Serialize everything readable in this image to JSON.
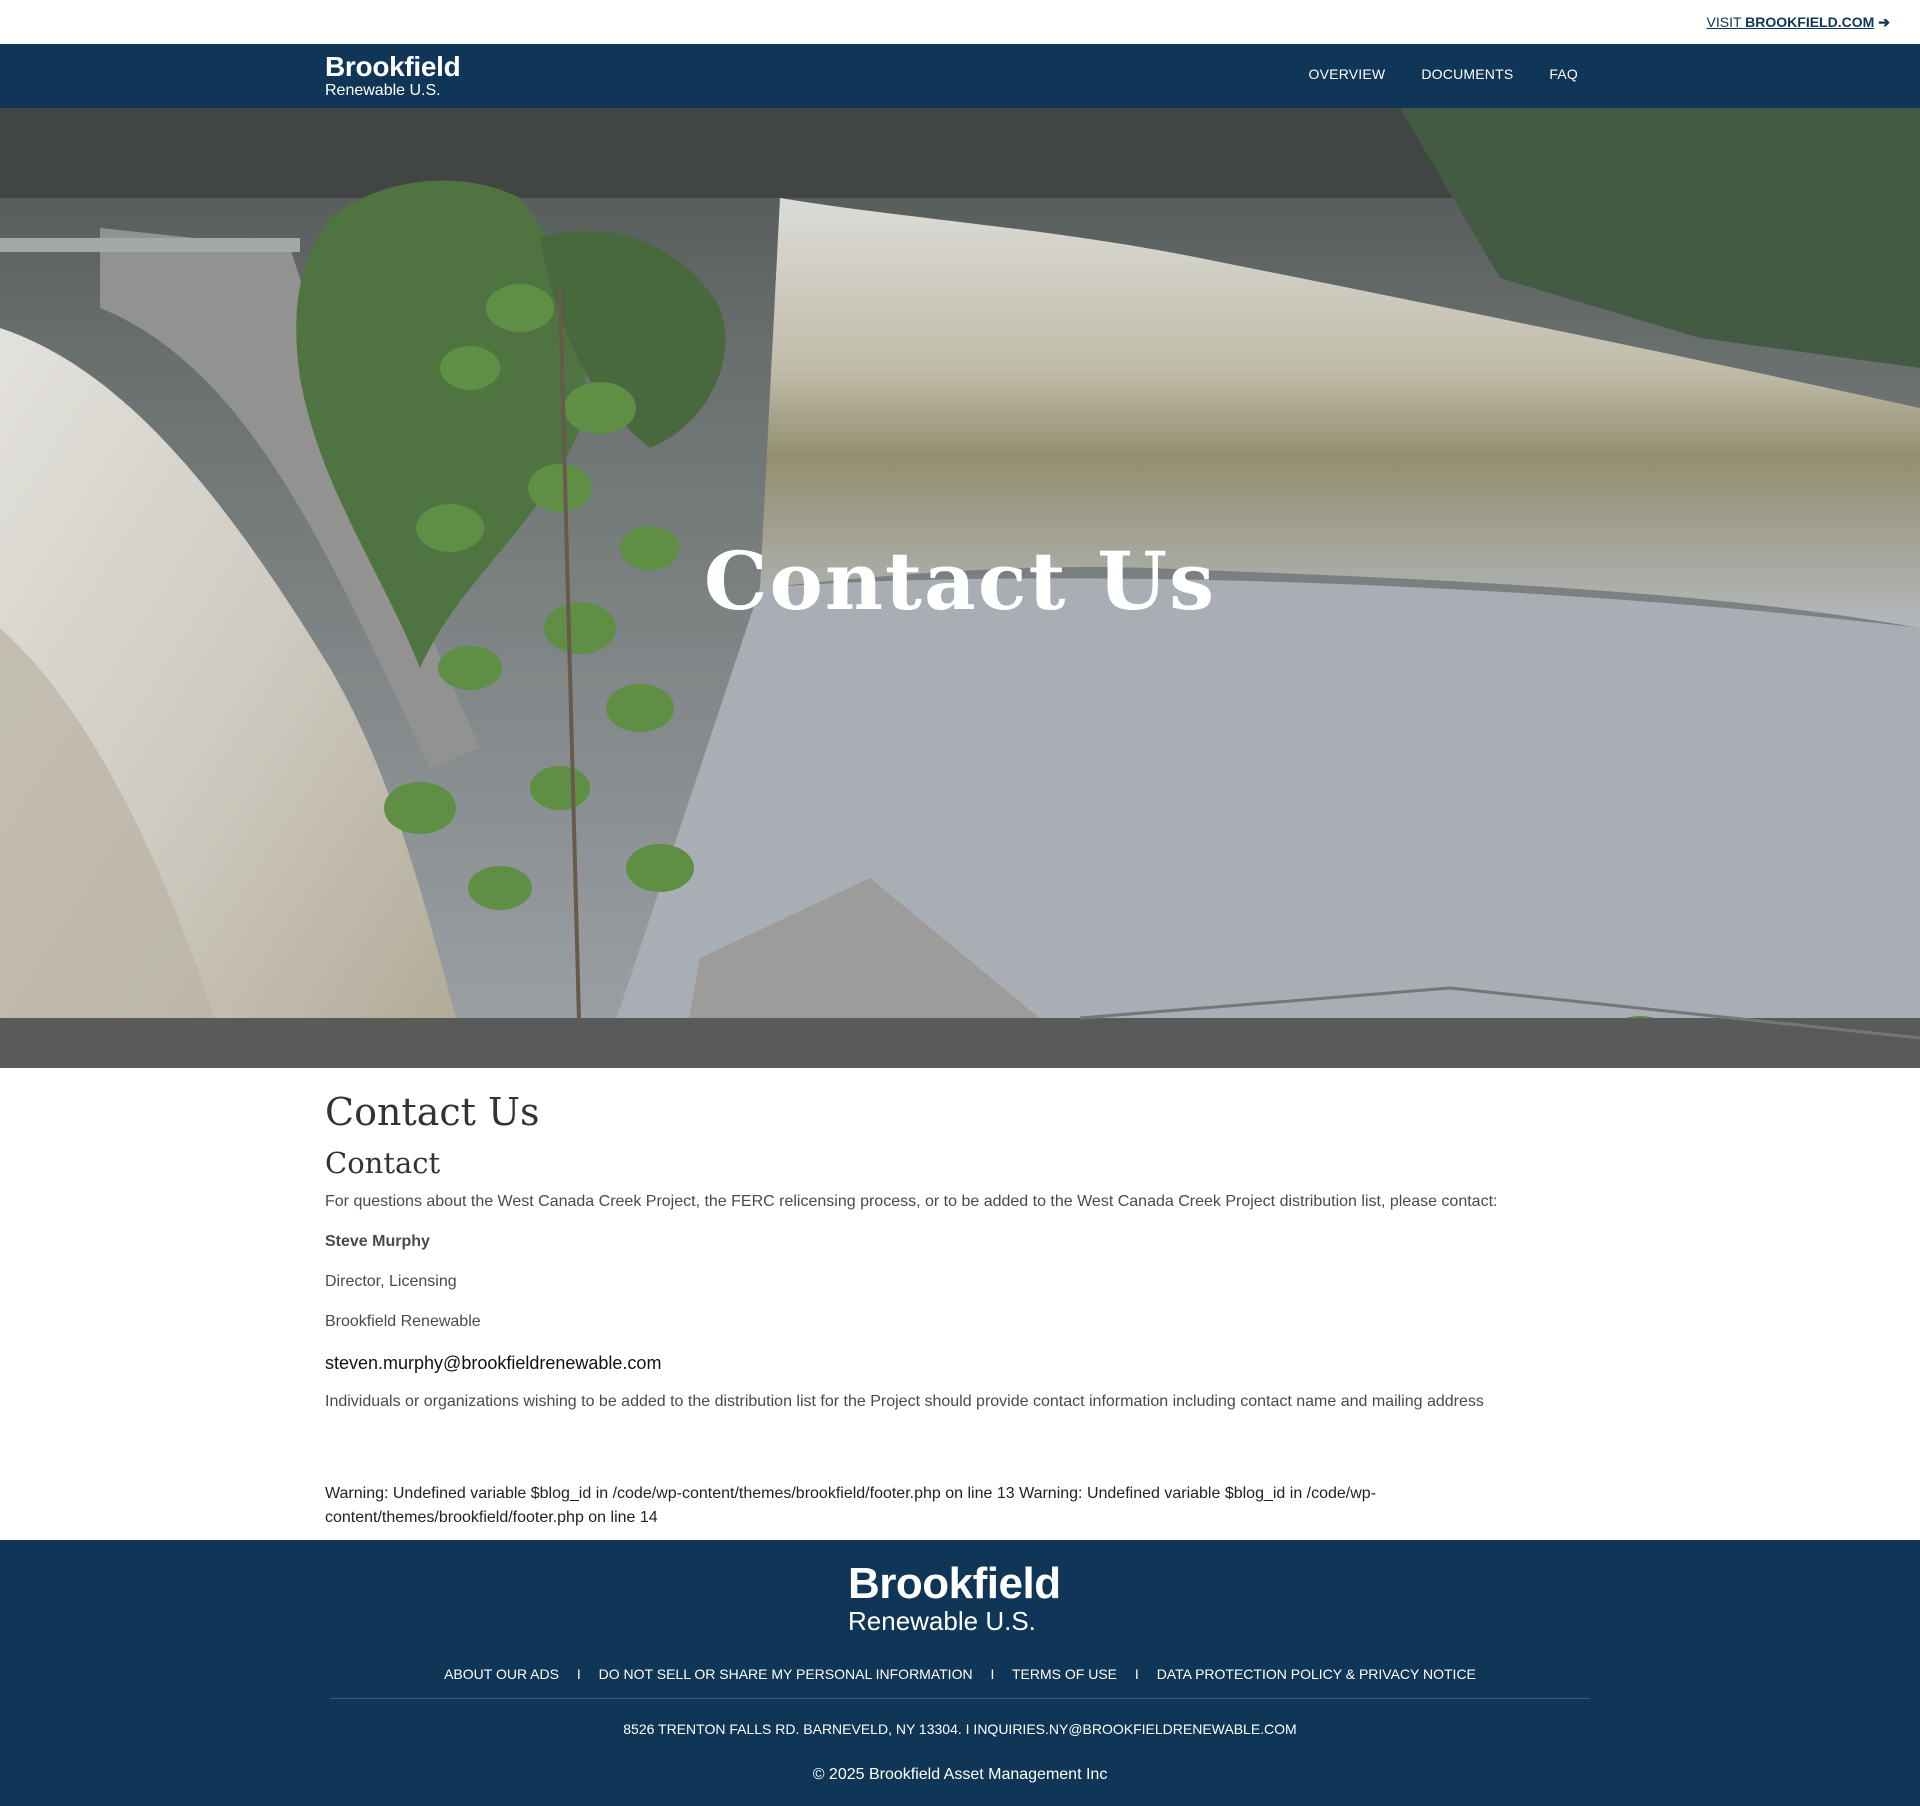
{
  "utility": {
    "visit_prefix": "VISIT ",
    "visit_site": "BROOKFIELD.COM",
    "arrow": "➔"
  },
  "nav": {
    "brand_name": "Brookfield",
    "brand_sub": "Renewable U.S.",
    "items": [
      {
        "label": "OVERVIEW"
      },
      {
        "label": "DOCUMENTS"
      },
      {
        "label": "FAQ"
      }
    ]
  },
  "hero": {
    "title": "Contact Us",
    "image": "hydro-dam-waterfall-photo"
  },
  "content": {
    "page_title": "Contact Us",
    "section_title": "Contact",
    "intro": "For questions about the West Canada Creek Project, the FERC relicensing process, or to be added to the West Canada Creek Project distribution list, please contact:",
    "contact_name": "Steve Murphy",
    "contact_role": "Director, Licensing",
    "contact_org": "Brookfield Renewable",
    "contact_email": "steven.murphy@brookfieldrenewable.com",
    "note": "Individuals or organizations wishing to be added to the distribution list for the Project should provide contact information including contact name and mailing address",
    "warning": "Warning: Undefined variable $blog_id in /code/wp-content/themes/brookfield/footer.php on line 13 Warning: Undefined variable $blog_id in /code/wp-content/themes/brookfield/footer.php on line 14"
  },
  "footer": {
    "brand_name": "Brookfield",
    "brand_sub": "Renewable U.S.",
    "separator": "I",
    "links": [
      {
        "label": "ABOUT OUR ADS"
      },
      {
        "label": "DO NOT SELL OR SHARE MY PERSONAL INFORMATION"
      },
      {
        "label": "TERMS OF USE"
      },
      {
        "label": "DATA PROTECTION POLICY & PRIVACY NOTICE"
      }
    ],
    "address": "8526 TRENTON FALLS RD. BARNEVELD, NY 13304. I INQUIRIES.NY@BROOKFIELDRENEWABLE.COM",
    "copyright": "© 2025 Brookfield Asset Management Inc"
  },
  "colors": {
    "navy": "#0f3557",
    "white": "#ffffff",
    "text": "#4a4a4a",
    "heading": "#333333"
  }
}
